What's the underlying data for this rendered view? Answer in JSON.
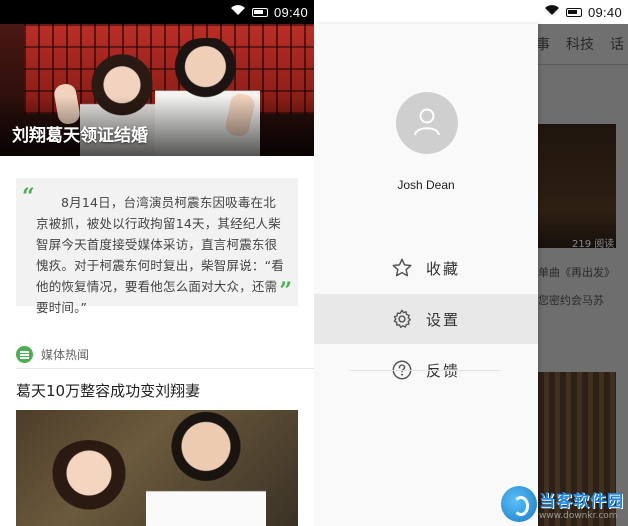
{
  "status": {
    "time": "09:40"
  },
  "left": {
    "hero": {
      "title": "刘翔葛天领证结婚"
    },
    "quote": {
      "open_mark": "“",
      "close_mark": "”",
      "text": "8月14日，台湾演员柯震东因吸毒在北京被抓，被处以行政拘留14天，其经纪人柴智屏今天首度接受媒体采访，直言柯震东很愧疚。对于柯震东何时复出，柴智屏说：“看他的恢复情况，要看他怎么面对大众，还需要时间。”"
    },
    "section": {
      "label": "媒体热闻",
      "icon": "news-icon"
    },
    "article": {
      "title": "葛天10万整容成功变刘翔妻"
    }
  },
  "right": {
    "background": {
      "tabs": [
        "事",
        "科技",
        "话"
      ],
      "read_count": "219 阅读",
      "text1": "单曲《再出发》",
      "text2": "您密约会马苏"
    },
    "drawer": {
      "user_name": "Josh Dean",
      "menu": [
        {
          "label": "收藏",
          "icon": "star-icon"
        },
        {
          "label": "设置",
          "icon": "gear-icon",
          "active": true
        },
        {
          "label": "反馈",
          "icon": "question-icon"
        }
      ]
    },
    "watermark": {
      "brand": "当客软件园",
      "url": "www.downkr.com"
    }
  },
  "colors": {
    "accent": "#4caf50",
    "drawer_bg": "#f9f9f9",
    "overlay": "#6e6e6e",
    "active_row": "#e8e8e8",
    "watermark": "#1e88e5"
  }
}
